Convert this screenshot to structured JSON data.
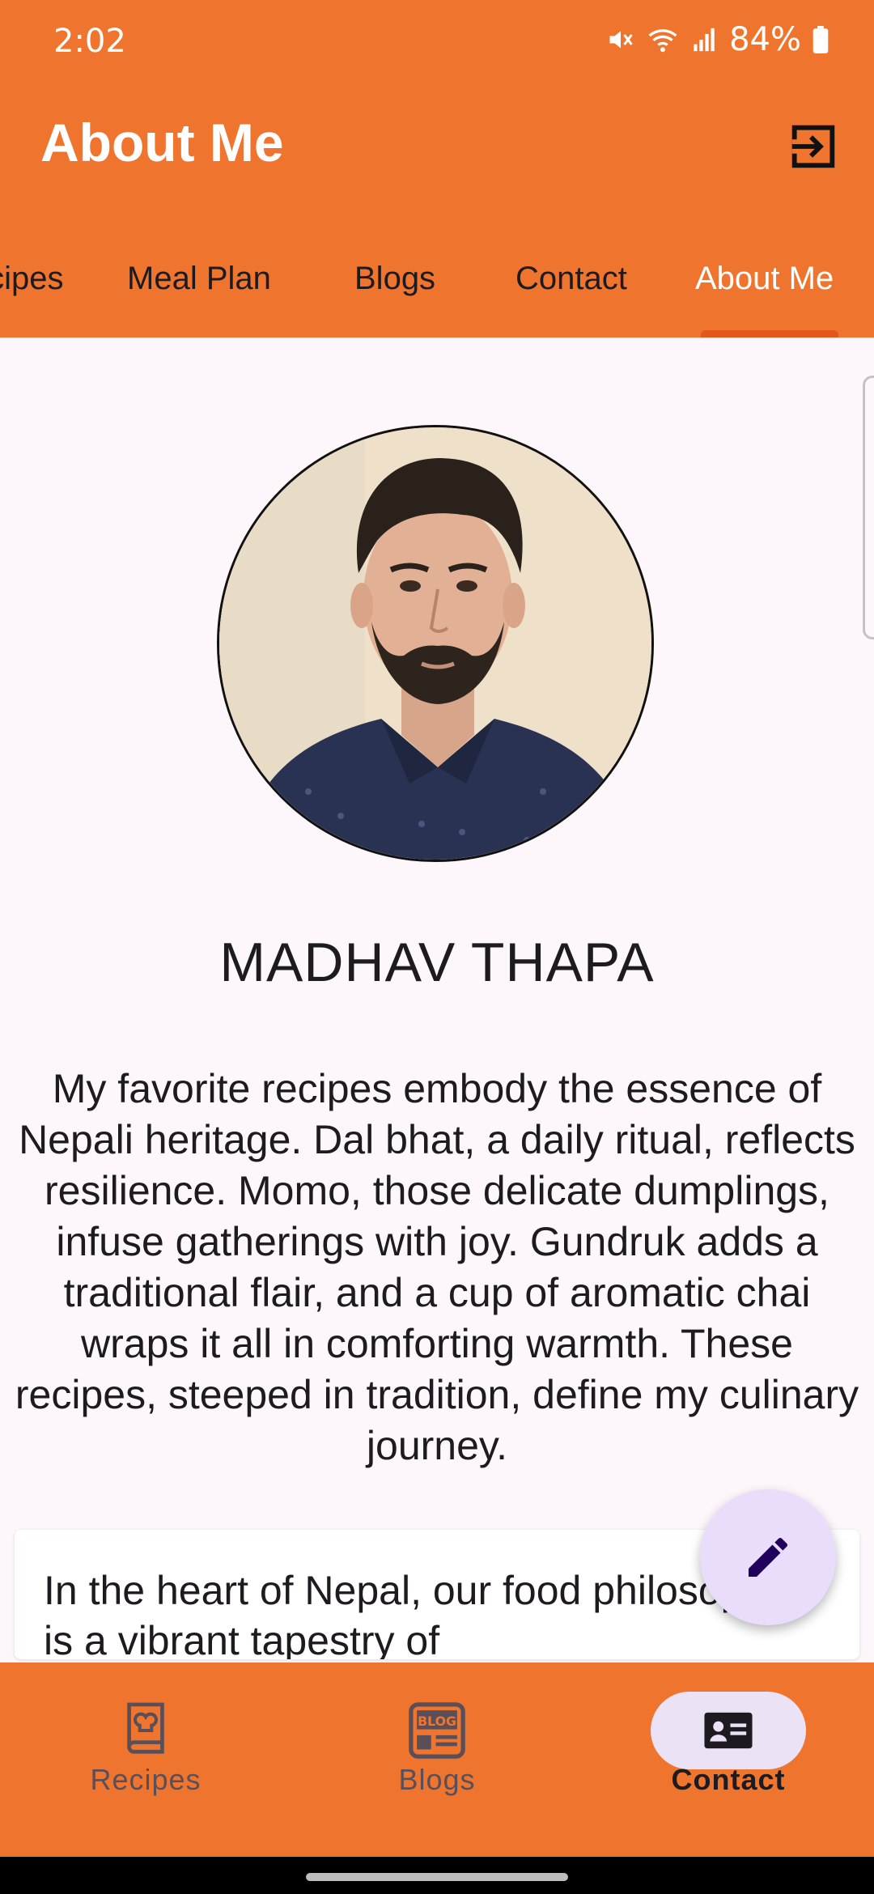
{
  "status_bar": {
    "time": "2:02",
    "battery": "84%"
  },
  "app_bar": {
    "title": "About Me"
  },
  "tabs": [
    {
      "label": "Recipes"
    },
    {
      "label": "Meal Plan"
    },
    {
      "label": "Blogs"
    },
    {
      "label": "Contact"
    },
    {
      "label": "About Me",
      "active": true
    }
  ],
  "profile": {
    "name": "MADHAV THAPA",
    "bio": "My favorite recipes embody the essence of Nepali heritage. Dal bhat, a daily ritual, reflects resilience. Momo, those delicate dumplings, infuse gatherings with joy. Gundruk adds a traditional flair, and a cup of aromatic chai wraps it all in comforting warmth. These recipes, steeped in tradition, define my culinary journey."
  },
  "philosophy_card": {
    "text": "In the heart of Nepal, our food philosophy is a vibrant tapestry of"
  },
  "bottom_nav": [
    {
      "label": "Recipes",
      "icon": "recipe-book-icon"
    },
    {
      "label": "Blogs",
      "icon": "blog-icon",
      "icon_text": "BLOG"
    },
    {
      "label": "Contact",
      "icon": "contact-card-icon",
      "active": true
    }
  ],
  "colors": {
    "primary": "#ef752e",
    "indicator": "#e3561c",
    "background": "#fdf7fc",
    "fab": "#e9ddfb",
    "nav_active_pill": "#ece2f6"
  }
}
